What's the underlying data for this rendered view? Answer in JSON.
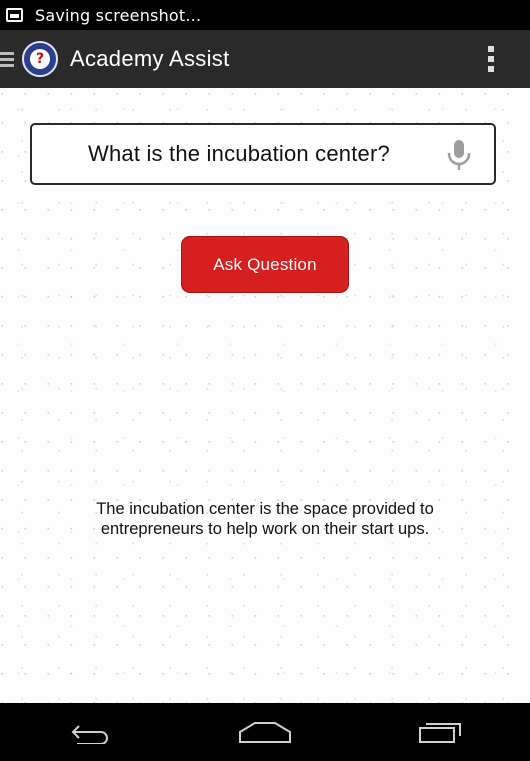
{
  "status_bar": {
    "notification_text": "Saving screenshot...",
    "icon": "image-icon"
  },
  "action_bar": {
    "title": "Academy Assist",
    "logo_text": "?"
  },
  "form": {
    "question_value": "What is the incubation center?",
    "ask_button_label": "Ask Question"
  },
  "answer": {
    "line1": "The incubation center is the space provided to",
    "line2": "entrepreneurs to help work on their start ups."
  },
  "navigation": {
    "icons": [
      "back-icon",
      "home-icon",
      "recents-icon"
    ]
  },
  "colors": {
    "action_bar": "#2a2a2a",
    "button": "#d61f1f",
    "content_bg": "#fdfdfd"
  }
}
